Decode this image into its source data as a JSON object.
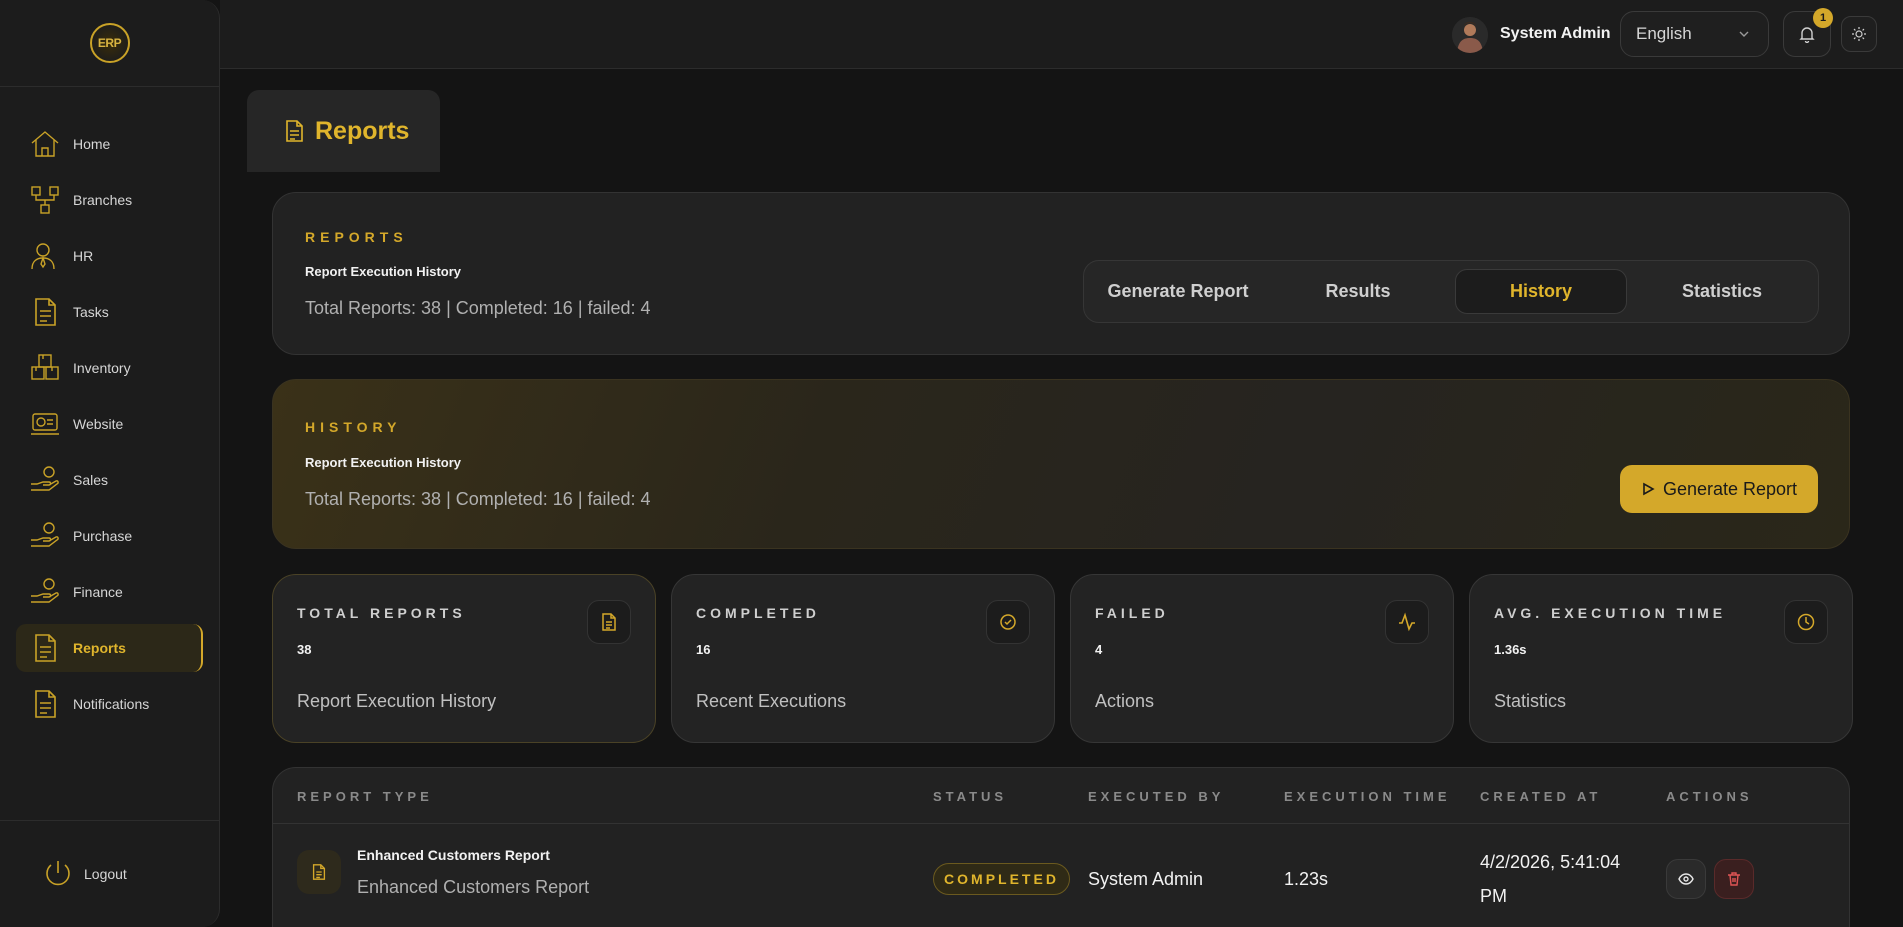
{
  "app": {
    "logo_text": "ERP"
  },
  "sidebar": {
    "items": [
      {
        "label": "Home",
        "icon": "home-icon"
      },
      {
        "label": "Branches",
        "icon": "branches-icon"
      },
      {
        "label": "HR",
        "icon": "hr-icon"
      },
      {
        "label": "Tasks",
        "icon": "document-icon"
      },
      {
        "label": "Inventory",
        "icon": "inventory-icon"
      },
      {
        "label": "Website",
        "icon": "website-icon"
      },
      {
        "label": "Sales",
        "icon": "hand-coins-icon"
      },
      {
        "label": "Purchase",
        "icon": "hand-coins-icon"
      },
      {
        "label": "Finance",
        "icon": "hand-coins-icon"
      },
      {
        "label": "Reports",
        "icon": "document-icon",
        "active": true
      },
      {
        "label": "Notifications",
        "icon": "document-icon"
      }
    ],
    "logout_label": "Logout"
  },
  "topbar": {
    "user_name": "System Admin",
    "language": "English",
    "notification_count": "1"
  },
  "page": {
    "title": "Reports"
  },
  "reports_card": {
    "label": "REPORTS",
    "subtitle": "Report Execution History",
    "summary": "Total Reports: 38 | Completed: 16 | failed: 4"
  },
  "tabs": [
    {
      "label": "Generate Report"
    },
    {
      "label": "Results"
    },
    {
      "label": "History",
      "active": true
    },
    {
      "label": "Statistics"
    }
  ],
  "history_card": {
    "label": "HISTORY",
    "subtitle": "Report Execution History",
    "summary": "Total Reports: 38 | Completed: 16 | failed: 4",
    "button_label": "Generate Report"
  },
  "stats": [
    {
      "label": "TOTAL REPORTS",
      "value": "38",
      "desc": "Report Execution History",
      "icon": "document-icon"
    },
    {
      "label": "COMPLETED",
      "value": "16",
      "desc": "Recent Executions",
      "icon": "check-circle-icon"
    },
    {
      "label": "FAILED",
      "value": "4",
      "desc": "Actions",
      "icon": "activity-icon"
    },
    {
      "label": "AVG. EXECUTION TIME",
      "value": "1.36s",
      "desc": "Statistics",
      "icon": "clock-icon"
    }
  ],
  "table": {
    "headers": [
      "REPORT TYPE",
      "STATUS",
      "EXECUTED BY",
      "EXECUTION TIME",
      "CREATED AT",
      "ACTIONS"
    ],
    "rows": [
      {
        "title": "Enhanced Customers Report",
        "subtitle": "Enhanced Customers Report",
        "status": "COMPLETED",
        "executed_by": "System Admin",
        "execution_time": "1.23s",
        "created_at_line1": "4/2/2026, 5:41:04",
        "created_at_line2": "PM"
      }
    ]
  },
  "colors": {
    "accent": "#d4a82a",
    "background": "#141414",
    "surface": "#222222",
    "danger": "#e05555"
  }
}
